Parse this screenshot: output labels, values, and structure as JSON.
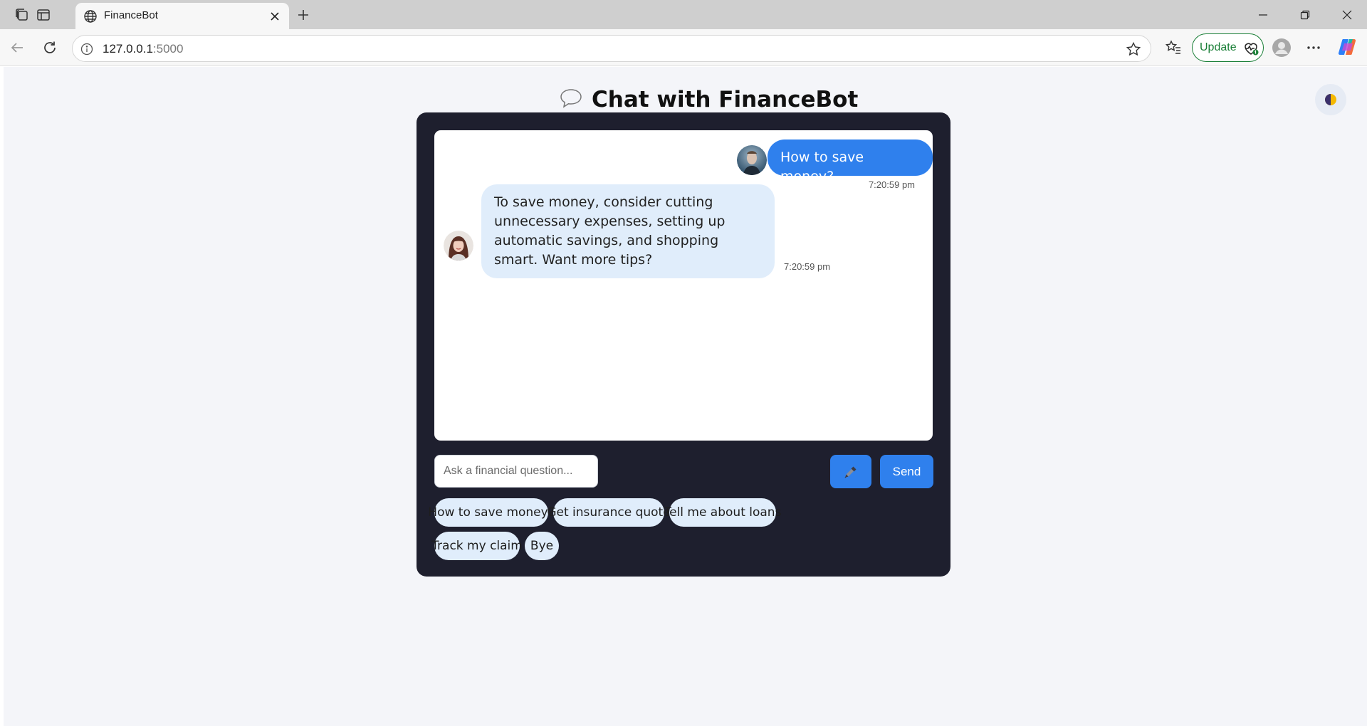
{
  "browser": {
    "tab_title": "FinanceBot",
    "address_host": "127.0.0.1",
    "address_port": ":5000",
    "update_label": "Update"
  },
  "page": {
    "title": "Chat with FinanceBot"
  },
  "chat": {
    "messages": [
      {
        "sender": "user",
        "text": "How to save money?",
        "time": "7:20:59 pm"
      },
      {
        "sender": "bot",
        "text": "To save money, consider cutting unnecessary expenses, setting up automatic savings, and shopping smart. Want more tips?",
        "time": "7:20:59 pm"
      }
    ]
  },
  "composer": {
    "placeholder": "Ask a financial question...",
    "send_label": "Send"
  },
  "quick_replies": [
    "How to save money?",
    "Get insurance quote",
    "Tell me about loans",
    "Track my claim",
    "Bye"
  ],
  "colors": {
    "accent": "#2f80ed",
    "card_bg": "#1e1f2e",
    "bot_bubble": "#e0edfb",
    "page_bg": "#f4f5f9"
  }
}
